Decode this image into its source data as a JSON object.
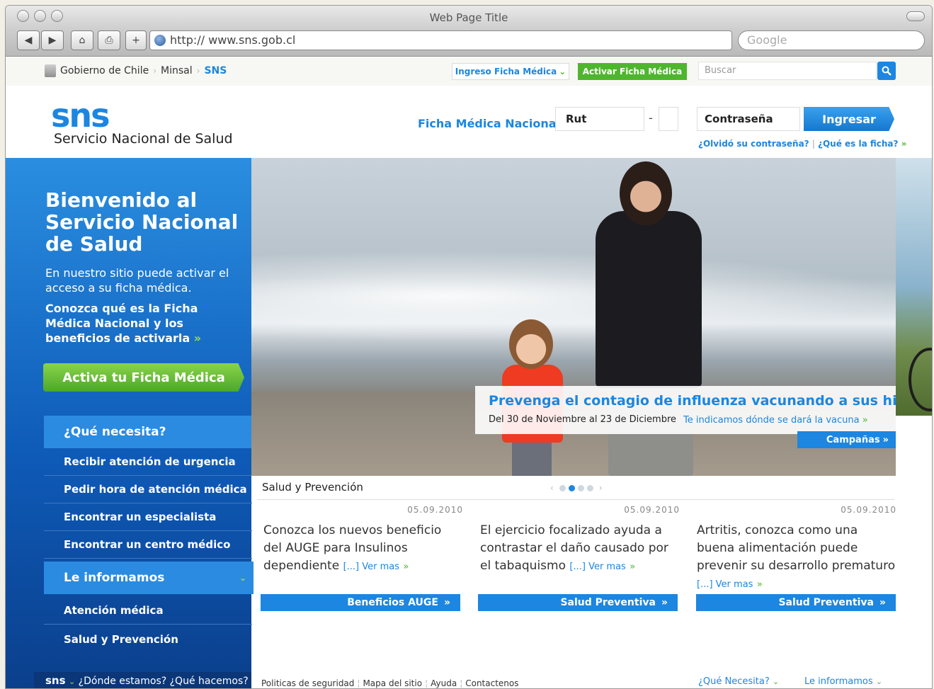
{
  "browser": {
    "window_title": "Web Page Title",
    "url": "http:// www.sns.gob.cl",
    "search_placeholder": "Google"
  },
  "utility_bar": {
    "crumbs": [
      "Gobierno de Chile",
      "Minsal",
      "SNS"
    ],
    "crumb_separator": "›",
    "ingreso_label": "Ingreso Ficha Médica",
    "activar_label": "Activar Ficha Médica",
    "search_placeholder": "Buscar"
  },
  "header": {
    "logo": "sns",
    "logo_subtitle": "Servicio Nacional de Salud",
    "ficha_label": "Ficha Médica Nacional",
    "rut_placeholder": "Rut",
    "dash": "-",
    "password_placeholder": "Contraseña",
    "login_button": "Ingresar",
    "forgot_link": "¿Olvidó su contraseña?",
    "what_link": "¿Qué es la ficha?",
    "what_arrow": "»",
    "links_separator": "|"
  },
  "left_panel": {
    "welcome_title": "Bienvenido al Servicio Nacional de Salud",
    "welcome_text": "En nuestro sitio puede activar el acceso a su ficha médica.",
    "welcome_link": "Conozca qué es la Ficha Médica Nacional y los beneficios de activarla",
    "welcome_link_arrow": "»",
    "activate_button": "Activa tu Ficha Médica",
    "menu1_title": "¿Qué necesita?",
    "menu1_items": [
      "Recibir atención de urgencia",
      "Pedir hora de atención médica",
      "Encontrar un especialista",
      "Encontrar un centro médico"
    ],
    "menu2_title": "Le informamos",
    "menu2_items": [
      "Atención médica",
      "Salud y Prevención"
    ],
    "bottom_logo": "sns",
    "bottom_text": "¿Dónde estamos? ¿Qué hacemos?"
  },
  "hero": {
    "title": "Prevenga el contagio de influenza vacunando a sus hijos",
    "date_text": "Del 30 de Noviembre al 23 de Diciembre",
    "link_text": "Te indicamos dónde se dará la vacuna",
    "link_arrow": "»",
    "campaign_button": "Campañas",
    "button_arrow": "»"
  },
  "news_section": {
    "title": "Salud y Prevención",
    "more_label": "[...] Ver mas",
    "more_arrow": "»",
    "items": [
      {
        "date": "05.09.2010",
        "text": "Conozca los nuevos beneficio del AUGE para Insulinos dependiente",
        "button": "Beneficios AUGE"
      },
      {
        "date": "05.09.2010",
        "text": "El ejercicio focalizado ayuda a contrastar el daño causado por el tabaquismo",
        "button": "Salud Preventiva"
      },
      {
        "date": "05.09.2010",
        "text": "Artritis, conozca como una buena alimentación puede prevenir su desarrollo prematuro",
        "button": "Salud Preventiva"
      }
    ],
    "button_arrow": "»"
  },
  "footer": {
    "links": [
      "Politicas de seguridad",
      "Mapa del sitio",
      "Ayuda",
      "Contactenos"
    ],
    "link_separator": "¦",
    "right_menu1": "¿Qué Necesita?",
    "right_menu2": "Le informamos"
  },
  "colors": {
    "brand_blue": "#1c86e0",
    "brand_green": "#4eb62e",
    "panel_dark": "#0e5bb8"
  }
}
